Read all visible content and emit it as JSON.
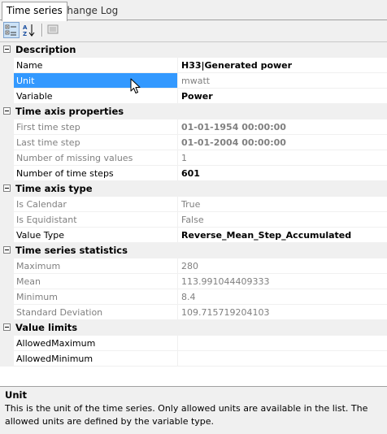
{
  "tabs": [
    {
      "label": "Time series"
    },
    {
      "label": "Change Log"
    }
  ],
  "toolbar": {
    "categorized_icon": "categorized-view-icon",
    "alphabetical_icon": "alphabetical-sort-icon",
    "pages_icon": "property-pages-icon"
  },
  "sections": [
    {
      "title": "Description",
      "rows": [
        {
          "name": "Name",
          "value": "H33|Generated power"
        },
        {
          "name": "Unit",
          "value": "mwatt"
        },
        {
          "name": "Variable",
          "value": "Power"
        }
      ]
    },
    {
      "title": "Time axis properties",
      "rows": [
        {
          "name": "First time step",
          "value": "01-01-1954 00:00:00"
        },
        {
          "name": "Last time step",
          "value": "01-01-2004 00:00:00"
        },
        {
          "name": "Number of missing values",
          "value": "1"
        },
        {
          "name": "Number of time steps",
          "value": "601"
        }
      ]
    },
    {
      "title": "Time axis type",
      "rows": [
        {
          "name": "Is Calendar",
          "value": "True"
        },
        {
          "name": "Is Equidistant",
          "value": "False"
        },
        {
          "name": "Value Type",
          "value": "Reverse_Mean_Step_Accumulated"
        }
      ]
    },
    {
      "title": "Time series statistics",
      "rows": [
        {
          "name": "Maximum",
          "value": "280"
        },
        {
          "name": "Mean",
          "value": "113.991044409333"
        },
        {
          "name": "Minimum",
          "value": "8.4"
        },
        {
          "name": "Standard Deviation",
          "value": "109.715719204103"
        }
      ]
    },
    {
      "title": "Value limits",
      "rows": [
        {
          "name": "AllowedMaximum",
          "value": ""
        },
        {
          "name": "AllowedMinimum",
          "value": ""
        }
      ]
    }
  ],
  "help": {
    "title": "Unit",
    "text": "This is the unit of the time series. Only allowed units are available in the list. The allowed units are defined by the variable type."
  },
  "colors": {
    "selection": "#3399ff",
    "category_bg": "#f0f0f0",
    "readonly_text": "#808080"
  }
}
